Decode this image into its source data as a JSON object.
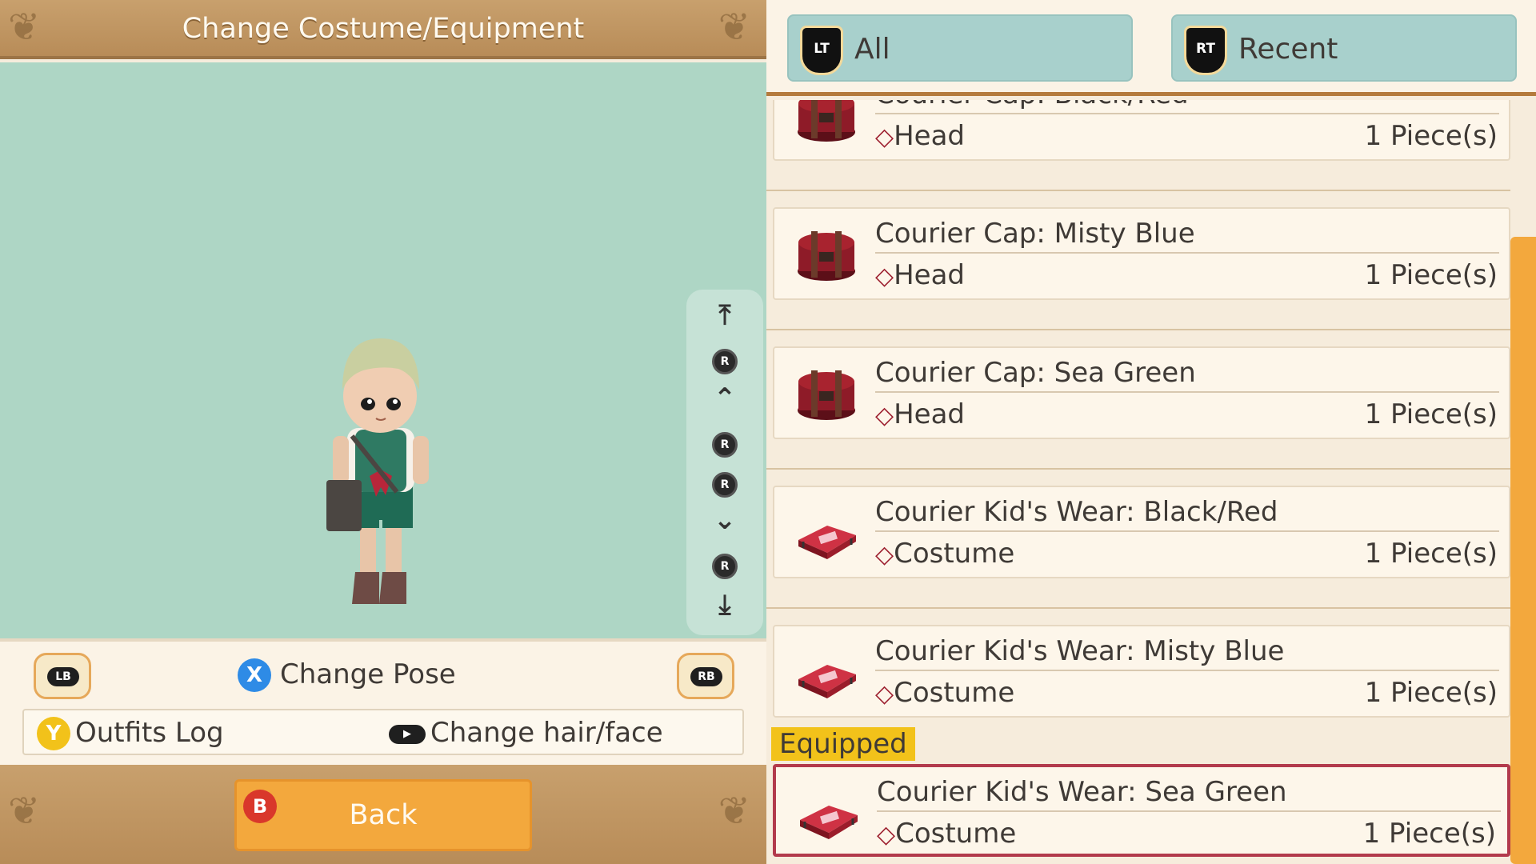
{
  "header": {
    "title": "Change Costume/Equipment"
  },
  "camera_controls": {
    "icons": [
      "top-arrow-icon",
      "rstick-up-icon",
      "double-up-icon",
      "rstick-left-icon",
      "rstick-right-icon",
      "double-down-icon",
      "rstick-down-icon",
      "bottom-arrow-icon"
    ],
    "r_label": "R"
  },
  "controls": {
    "lb_label": "LB",
    "rb_label": "RB",
    "x_button": "X",
    "change_pose": "Change Pose",
    "y_button": "Y",
    "outfits_log": "Outfits Log",
    "change_hair_face": "Change hair/face"
  },
  "footer": {
    "b_button": "B",
    "back_label": "Back"
  },
  "tabs": [
    {
      "trigger": "LT",
      "label": "All"
    },
    {
      "trigger": "RT",
      "label": "Recent"
    }
  ],
  "items": [
    {
      "name": "Courier Cap: Black/Red",
      "category": "Head",
      "quantity": "1 Piece(s)",
      "type": "cap",
      "equipped": false
    },
    {
      "name": "Courier Cap: Misty Blue",
      "category": "Head",
      "quantity": "1 Piece(s)",
      "type": "cap",
      "equipped": false
    },
    {
      "name": "Courier Cap: Sea Green",
      "category": "Head",
      "quantity": "1 Piece(s)",
      "type": "cap",
      "equipped": false
    },
    {
      "name": "Courier Kid's Wear: Black/Red",
      "category": "Costume",
      "quantity": "1 Piece(s)",
      "type": "wear",
      "equipped": false
    },
    {
      "name": "Courier Kid's Wear: Misty Blue",
      "category": "Costume",
      "quantity": "1 Piece(s)",
      "type": "wear",
      "equipped": false
    },
    {
      "name": "Courier Kid's Wear: Sea Green",
      "category": "Costume",
      "quantity": "1 Piece(s)",
      "type": "wear",
      "equipped": true
    }
  ],
  "equipped_tag": "Equipped",
  "colors": {
    "accent_orange": "#f3a83d",
    "tab_teal": "#a8d0cc",
    "stage_bg": "#aed6c5",
    "equipped_border": "#b23a4c",
    "equipped_tag": "#f2c21a"
  }
}
